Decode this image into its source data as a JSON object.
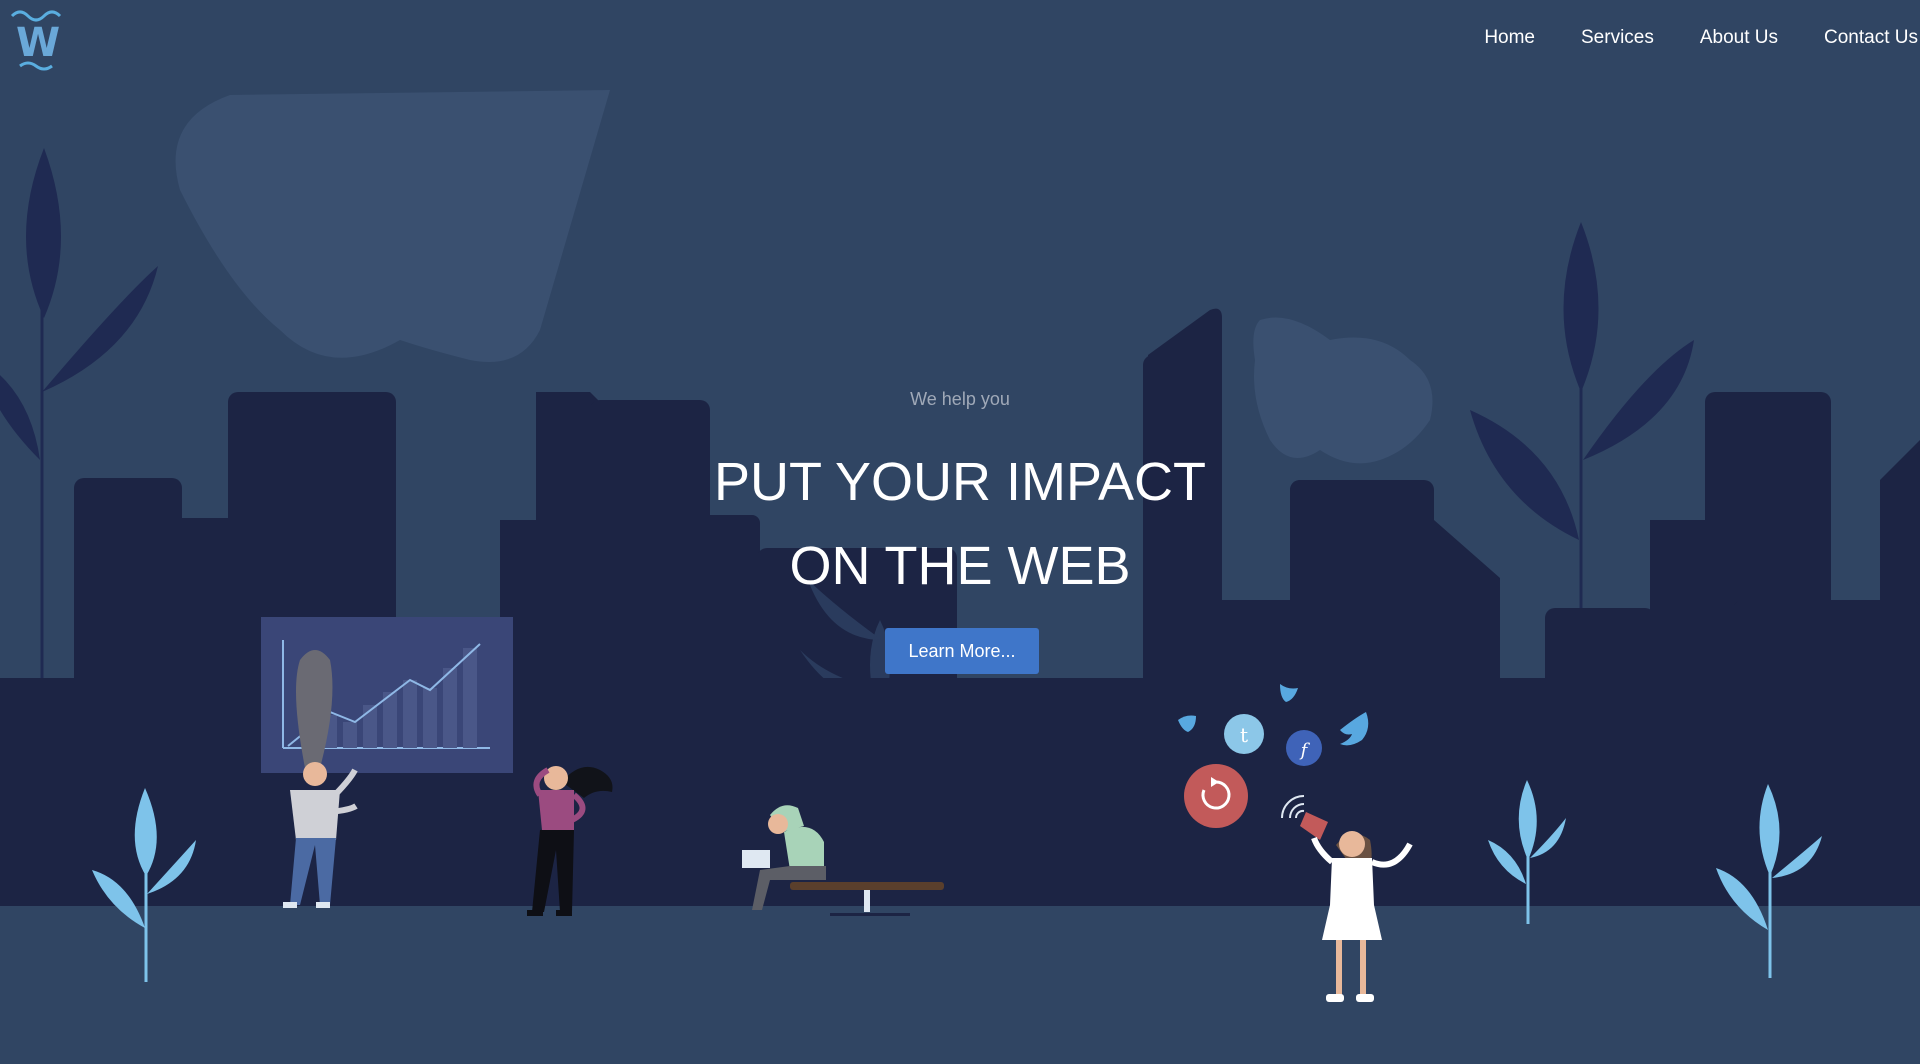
{
  "brand": {
    "logo_letter": "W"
  },
  "nav": {
    "items": [
      {
        "label": "Home"
      },
      {
        "label": "Services"
      },
      {
        "label": "About Us"
      },
      {
        "label": "Contact Us"
      }
    ]
  },
  "hero": {
    "tagline": "We help you",
    "headline_line1": "PUT YOUR IMPACT",
    "headline_line2": "ON THE WEB",
    "cta_label": "Learn More..."
  },
  "illustration": {
    "social_icons": [
      "twitter-bird-icon",
      "tumblr-icon",
      "facebook-icon",
      "refresh-icon"
    ],
    "social_glyphs": {
      "tumblr": "t",
      "facebook": "f",
      "refresh": "↻"
    }
  },
  "colors": {
    "background": "#304563",
    "building_dark": "#1c2444",
    "leaf_dark": "#1f2a52",
    "leaf_light": "#7ec3ea",
    "button": "#3f76c9",
    "chart_line": "#8fb8e6"
  }
}
